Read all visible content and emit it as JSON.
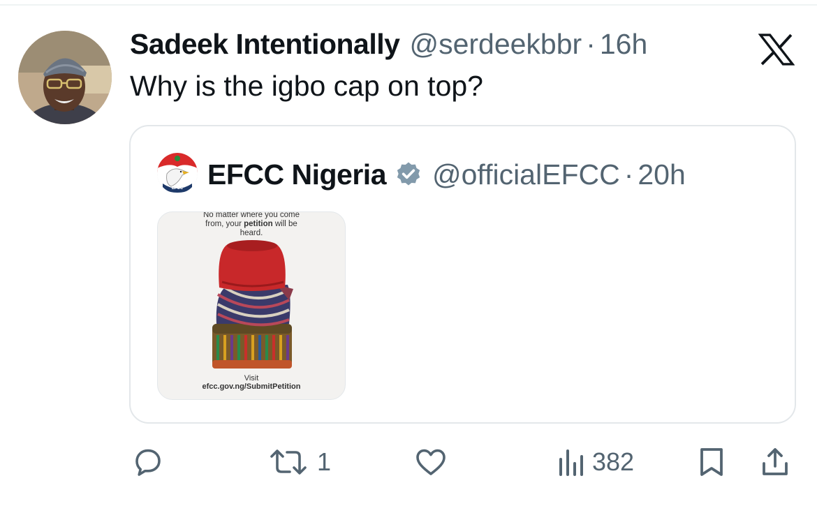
{
  "tweet": {
    "author_name": "Sadeek Intentionally",
    "author_handle": "@serdeekbbr",
    "separator": "·",
    "time": "16h",
    "text": "Why is the igbo cap on top?"
  },
  "quoted": {
    "author_name": "EFCC Nigeria",
    "author_handle": "@officialEFCC",
    "separator": "·",
    "time": "20h",
    "avatar_text": "EFCC",
    "media": {
      "top_line1": "No matter where you come",
      "top_line2_pre": "from, your ",
      "top_line2_bold": "petition",
      "top_line2_post": " will be",
      "top_line3": "heard.",
      "visit_label": "Visit",
      "url": "efcc.gov.ng/SubmitPetition"
    }
  },
  "actions": {
    "reply_count": "",
    "retweet_count": "1",
    "like_count": "",
    "views_count": "382"
  },
  "icons": {
    "logo": "x-logo-icon",
    "verified": "verified-badge-icon",
    "reply": "reply-icon",
    "retweet": "retweet-icon",
    "like": "heart-icon",
    "views": "views-icon",
    "bookmark": "bookmark-icon",
    "share": "share-icon"
  },
  "colors": {
    "text": "#0f1419",
    "secondary": "#536471",
    "verified_gray": "#829aab",
    "border": "#e3e7ea"
  }
}
